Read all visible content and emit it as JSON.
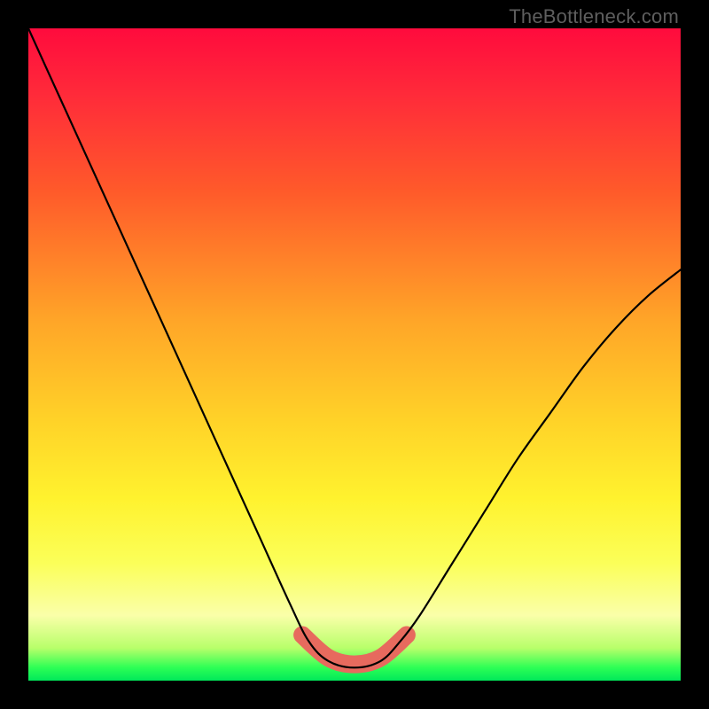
{
  "watermark": "TheBottleneck.com",
  "colors": {
    "frame": "#000000",
    "curve": "#000000",
    "band": "#e76a5e",
    "gradient_stops": [
      "#ff0b3d",
      "#ff2a3a",
      "#ff5a2a",
      "#ffa628",
      "#ffd228",
      "#fff22e",
      "#fbff59",
      "#faffa9",
      "#b8ff6a",
      "#2dff55",
      "#00e85a"
    ]
  },
  "chart_data": {
    "type": "line",
    "title": "",
    "xlabel": "",
    "ylabel": "",
    "xlim": [
      0,
      100
    ],
    "ylim": [
      0,
      100
    ],
    "series": [
      {
        "name": "curve",
        "x": [
          0,
          5,
          10,
          15,
          20,
          25,
          30,
          35,
          40,
          43,
          46,
          50,
          54,
          57,
          60,
          65,
          70,
          75,
          80,
          85,
          90,
          95,
          100
        ],
        "y": [
          100,
          89,
          78,
          67,
          56,
          45,
          34,
          23,
          12,
          6,
          3,
          2,
          3,
          6,
          10,
          18,
          26,
          34,
          41,
          48,
          54,
          59,
          63
        ]
      },
      {
        "name": "highlight-band",
        "x": [
          42,
          46,
          50,
          54,
          58
        ],
        "y": [
          7,
          3.5,
          2.5,
          3.5,
          7
        ]
      }
    ],
    "annotations": [
      {
        "text": "TheBottleneck.com",
        "position": "top-right"
      }
    ]
  }
}
